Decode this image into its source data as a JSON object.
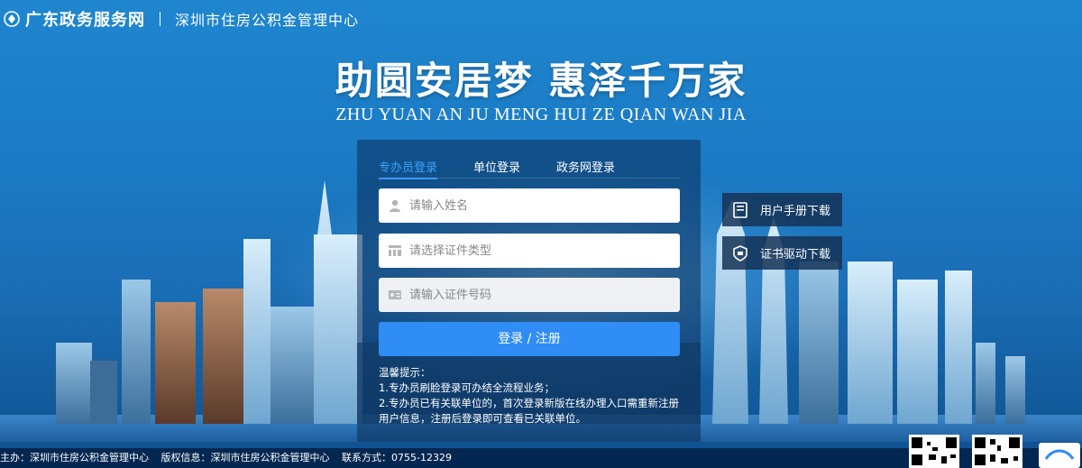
{
  "header": {
    "site_name": "广东政务服务网",
    "org_name": "深圳市住房公积金管理中心"
  },
  "slogan": {
    "title": "助圆安居梦 惠泽千万家",
    "subtitle": "ZHU YUAN AN JU MENG HUI ZE QIAN WAN JIA"
  },
  "login": {
    "tabs": [
      {
        "label": "专办员登录",
        "active": true
      },
      {
        "label": "单位登录",
        "active": false
      },
      {
        "label": "政务网登录",
        "active": false
      }
    ],
    "name_placeholder": "请输入姓名",
    "idtype_placeholder": "请选择证件类型",
    "idno_placeholder": "请输入证件号码",
    "submit_label": "登录 / 注册",
    "tips_title": "温馨提示：",
    "tips": [
      "1.专办员刷脸登录可办结全流程业务；",
      "2.专办员已有关联单位的，首次登录新版在线办理入口需重新注册用户信息，注册后登录即可查看已关联单位。"
    ]
  },
  "side_buttons": [
    {
      "label": "用户手册下载",
      "icon": "manual-icon"
    },
    {
      "label": "证书驱动下载",
      "icon": "certificate-icon"
    }
  ],
  "footer": {
    "host": "主办：深圳市住房公积金管理中心",
    "copyright": "版权信息：深圳市住房公积金管理中心",
    "contact": "联系方式：0755-12329"
  },
  "colors": {
    "accent": "#2f8df5",
    "tab_active": "#3aa3ff",
    "panel": "rgba(10,45,90,.55)"
  }
}
